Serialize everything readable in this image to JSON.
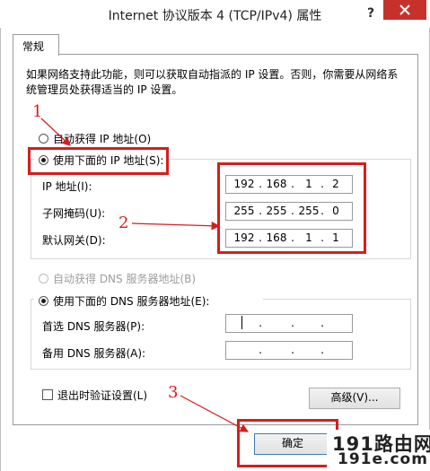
{
  "window": {
    "title": "Internet 协议版本 4 (TCP/IPv4) 属性",
    "help_glyph": "?"
  },
  "tabs": [
    {
      "label": "常规"
    }
  ],
  "description": "如果网络支持此功能，则可以获取自动指派的 IP 设置。否则，你需要从网络系统管理员处获得适当的 IP 设置。",
  "ip_mode": {
    "auto_label": "自动获得 IP 地址(O)",
    "manual_label": "使用下面的 IP 地址(S):",
    "selected": "manual"
  },
  "ip_fields": [
    {
      "label": "IP 地址(I):",
      "octets": [
        "192",
        "168",
        "1",
        "2"
      ]
    },
    {
      "label": "子网掩码(U):",
      "octets": [
        "255",
        "255",
        "255",
        "0"
      ]
    },
    {
      "label": "默认网关(D):",
      "octets": [
        "192",
        "168",
        "1",
        "1"
      ]
    }
  ],
  "dns_mode": {
    "auto_label": "自动获得 DNS 服务器地址(B)",
    "manual_label": "使用下面的 DNS 服务器地址(E):",
    "selected": "manual",
    "auto_disabled": true
  },
  "dns_fields": [
    {
      "label": "首选 DNS 服务器(P):",
      "octets": [
        "",
        "",
        "",
        ""
      ]
    },
    {
      "label": "备用 DNS 服务器(A):",
      "octets": [
        "",
        "",
        "",
        ""
      ]
    }
  ],
  "validate_on_exit": {
    "label": "退出时验证设置(L)",
    "checked": false
  },
  "buttons": {
    "advanced": "高级(V)...",
    "ok": "确定"
  },
  "annotations": {
    "step1": "1",
    "step2": "2",
    "step3": "3"
  },
  "watermark": {
    "line1": "191路由网",
    "line2": "191e.com"
  },
  "colors": {
    "annotation_red": "#d61d1d",
    "close_red": "#c7312c"
  }
}
